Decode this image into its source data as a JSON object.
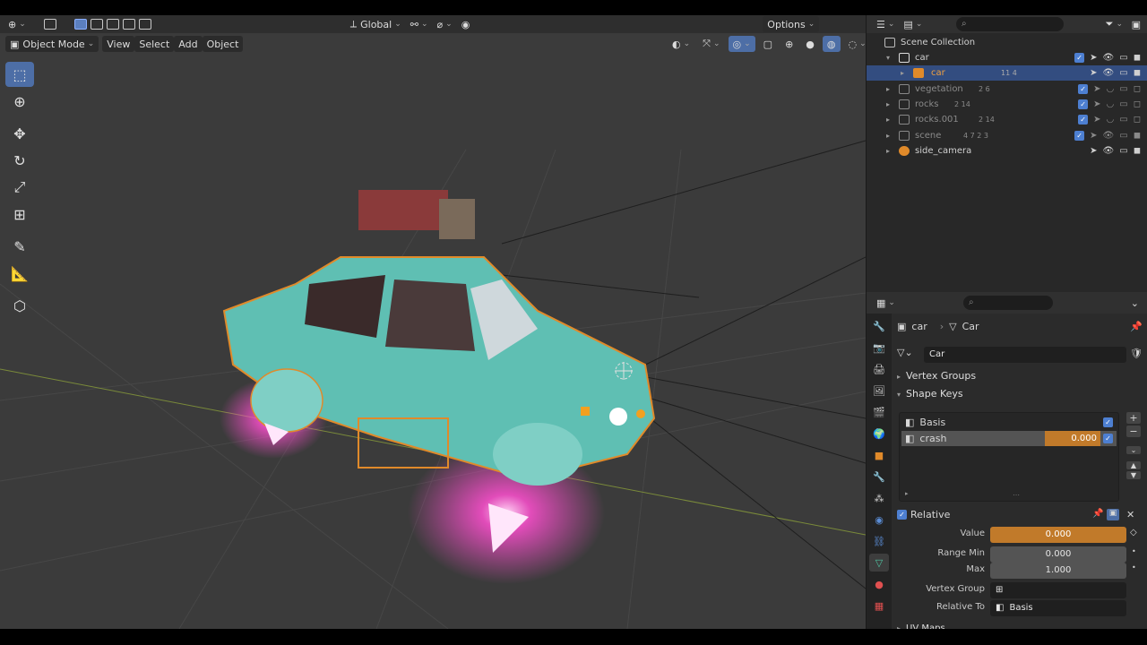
{
  "viewport": {
    "header": {
      "transform_orientation": "Global",
      "options_label": "Options"
    },
    "header2": {
      "mode": "Object Mode",
      "menus": [
        "View",
        "Select",
        "Add",
        "Object"
      ]
    }
  },
  "outliner": {
    "root": "Scene Collection",
    "rows": [
      {
        "name": "car",
        "counts": ""
      },
      {
        "name": "car",
        "counts": "11 4"
      },
      {
        "name": "vegetation",
        "counts": "2 6"
      },
      {
        "name": "rocks",
        "counts": "2 14"
      },
      {
        "name": "rocks.001",
        "counts": "2 14"
      },
      {
        "name": "scene",
        "counts": "4 7 2 3"
      },
      {
        "name": "side_camera",
        "counts": ""
      }
    ]
  },
  "properties": {
    "breadcrumb_object": "car",
    "breadcrumb_data": "Car",
    "mesh_name": "Car",
    "sections": {
      "vertex_groups": "Vertex Groups",
      "shape_keys": "Shape Keys",
      "uv_maps": "UV Maps"
    },
    "shape_keys": [
      {
        "name": "Basis",
        "value": ""
      },
      {
        "name": "crash",
        "value": "0.000"
      }
    ],
    "relative_label": "Relative",
    "value_label": "Value",
    "value": "0.000",
    "range_min_label": "Range Min",
    "range_min": "0.000",
    "max_label": "Max",
    "max": "1.000",
    "vertex_group_label": "Vertex Group",
    "relative_to_label": "Relative To",
    "relative_to": "Basis"
  },
  "colors": {
    "accent_blue": "#4d6ea6",
    "selection_orange": "#e08a2a",
    "car_teal": "#5fbfb3",
    "glow_pink": "#ff4fd0"
  }
}
